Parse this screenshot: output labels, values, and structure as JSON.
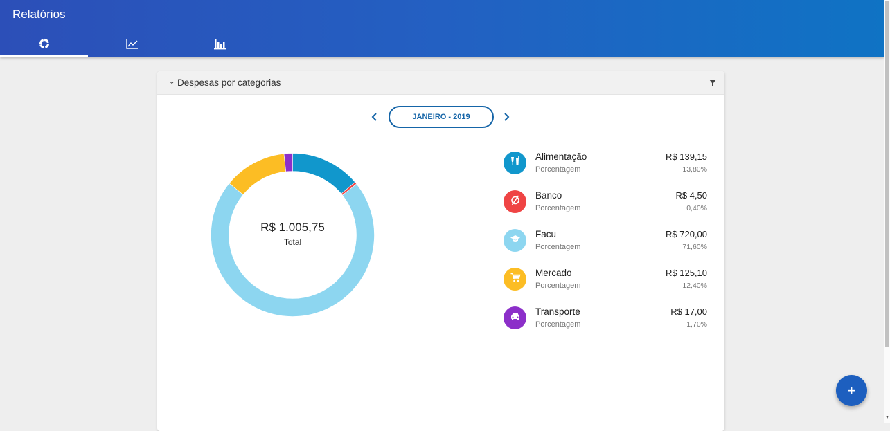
{
  "app": {
    "title": "Relatórios"
  },
  "tabs": [
    {
      "icon": "donut-chart-icon",
      "active": true
    },
    {
      "icon": "line-chart-icon",
      "active": false
    },
    {
      "icon": "bar-chart-icon",
      "active": false
    }
  ],
  "card": {
    "title": "Despesas por categorias",
    "month_label": "JANEIRO - 2019"
  },
  "donut": {
    "total_amount": "R$ 1.005,75",
    "total_label": "Total"
  },
  "chart_data": {
    "type": "pie",
    "categories": [
      "Alimentação",
      "Banco",
      "Facu",
      "Mercado",
      "Transporte"
    ],
    "values": [
      139.15,
      4.5,
      720.0,
      125.1,
      17.0
    ],
    "percentages": [
      13.8,
      0.4,
      71.6,
      12.4,
      1.7
    ],
    "colors": [
      "#1197cc",
      "#ef4444",
      "#8dd6f0",
      "#fcbd24",
      "#8c2fc9"
    ],
    "donut": true
  },
  "legend": [
    {
      "name": "Alimentação",
      "sublabel": "Porcentagem",
      "value": "R$ 139,15",
      "pct": "13,80%",
      "color": "#1197cc",
      "icon": "food-drink-icon"
    },
    {
      "name": "Banco",
      "sublabel": "Porcentagem",
      "value": "R$ 4,50",
      "pct": "0,40%",
      "color": "#ef4444",
      "icon": "empty-set-icon"
    },
    {
      "name": "Facu",
      "sublabel": "Porcentagem",
      "value": "R$ 720,00",
      "pct": "71,60%",
      "color": "#8dd6f0",
      "icon": "graduation-cap-icon"
    },
    {
      "name": "Mercado",
      "sublabel": "Porcentagem",
      "value": "R$ 125,10",
      "pct": "12,40%",
      "color": "#fcbd24",
      "icon": "shopping-cart-icon"
    },
    {
      "name": "Transporte",
      "sublabel": "Porcentagem",
      "value": "R$ 17,00",
      "pct": "1,70%",
      "color": "#8c2fc9",
      "icon": "car-icon"
    }
  ],
  "fab": {
    "label": "+"
  }
}
